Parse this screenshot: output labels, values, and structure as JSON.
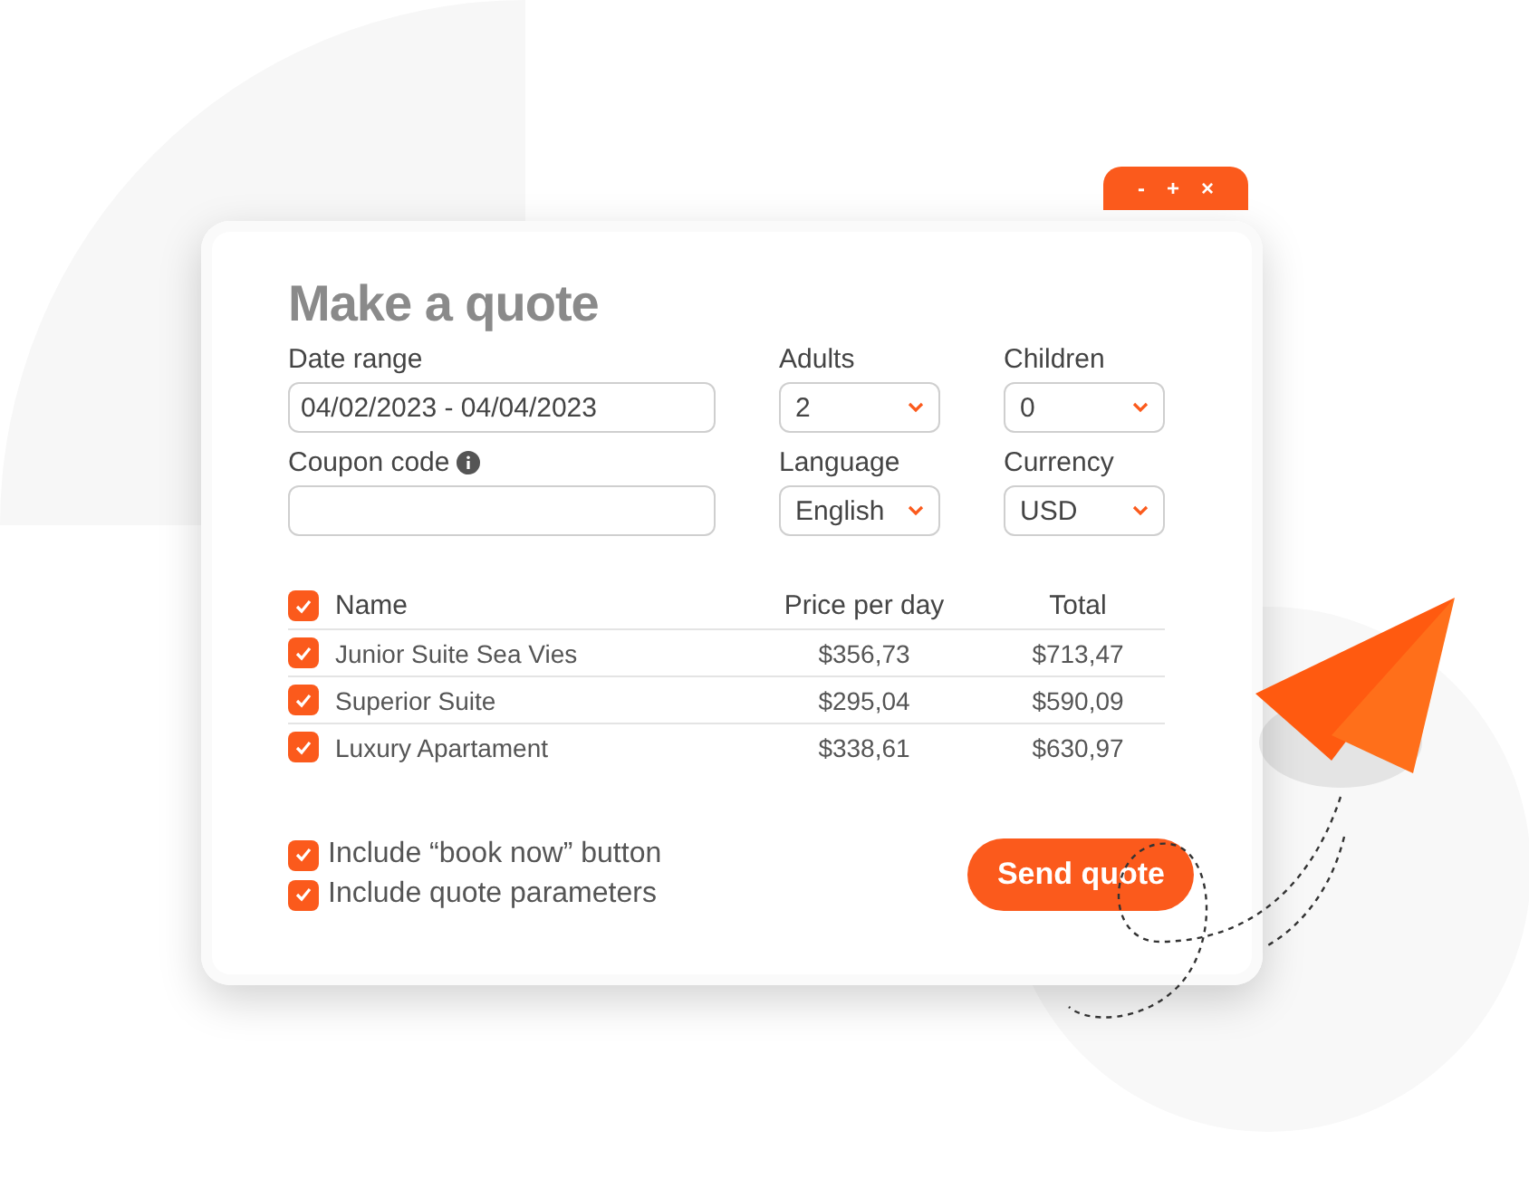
{
  "window": {
    "title": "Make a quote",
    "controls": [
      "-",
      "+",
      "×"
    ]
  },
  "fields": [
    {
      "label": "Date range",
      "kind": "text",
      "value": "04/02/2023 - 04/04/2023",
      "info": false
    },
    {
      "label": "Adults",
      "kind": "select",
      "value": "2",
      "info": false
    },
    {
      "label": "Children",
      "kind": "select",
      "value": "0",
      "info": false
    },
    {
      "label": "Coupon code",
      "kind": "text",
      "info": true
    },
    {
      "label": "Language",
      "kind": "select",
      "value": "English",
      "info": false
    },
    {
      "label": "Currency",
      "kind": "select",
      "value": "USD",
      "info": false
    }
  ],
  "table": {
    "all_checked": true,
    "columns": [
      "Name",
      "Price per day",
      "Total"
    ],
    "rows": [
      {
        "checked": true,
        "cells": [
          "Junior Suite Sea Vies",
          "$356,73",
          "$713,47"
        ]
      },
      {
        "checked": true,
        "cells": [
          "Superior Suite",
          "$295,04",
          "$590,09"
        ]
      },
      {
        "checked": true,
        "cells": [
          "Luxury Apartament",
          "$338,61",
          "$630,97"
        ]
      }
    ]
  },
  "options": [
    {
      "label": "Include “book now” button",
      "checked": true
    },
    {
      "label": "Include quote parameters",
      "checked": true
    }
  ],
  "button": "Send quote"
}
